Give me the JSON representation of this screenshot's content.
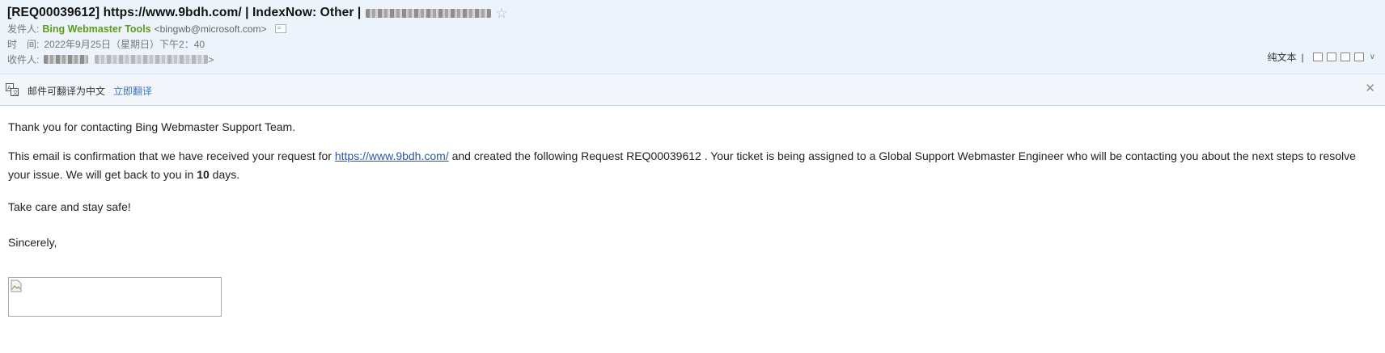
{
  "email": {
    "subject": "[REQ00039612] https://www.9bdh.com/ | IndexNow: Other |",
    "sender_label": "发件人:",
    "sender_name": "Bing Webmaster Tools",
    "sender_email": "<bingwb@microsoft.com>",
    "time_label": "时　间:",
    "time_value": "2022年9月25日（星期日）下午2：40",
    "recipient_label": "收件人:",
    "recipient_tail": ">"
  },
  "toolbar": {
    "plain_text_label": "纯文本",
    "separator": "|"
  },
  "translate_bar": {
    "message": "邮件可翻译为中文",
    "action_label": "立即翻译"
  },
  "body": {
    "greeting": "Thank you for contacting Bing Webmaster Support Team.",
    "p1_before_link": "This email is confirmation that we have received your request for ",
    "link_text": "https://www.9bdh.com/",
    "p1_after_link": " and created the following Request REQ00039612 . Your ticket is being assigned to a Global Support Webmaster Engineer who will be contacting you about the next steps to resolve your issue. We will get back to you in ",
    "days_number": "10",
    "p1_end": " days.",
    "closing_line": "Take care and stay safe!",
    "signoff": "Sincerely,"
  },
  "icons": [
    "star-icon",
    "contact-card-icon",
    "translate-icon",
    "close-icon",
    "new-window-icon",
    "print-icon",
    "more-chevron-icon",
    "broken-image-icon"
  ],
  "colors": {
    "sender_name": "#5c9d19",
    "link": "#2d55a5",
    "header_bg": "#edf3fa"
  }
}
